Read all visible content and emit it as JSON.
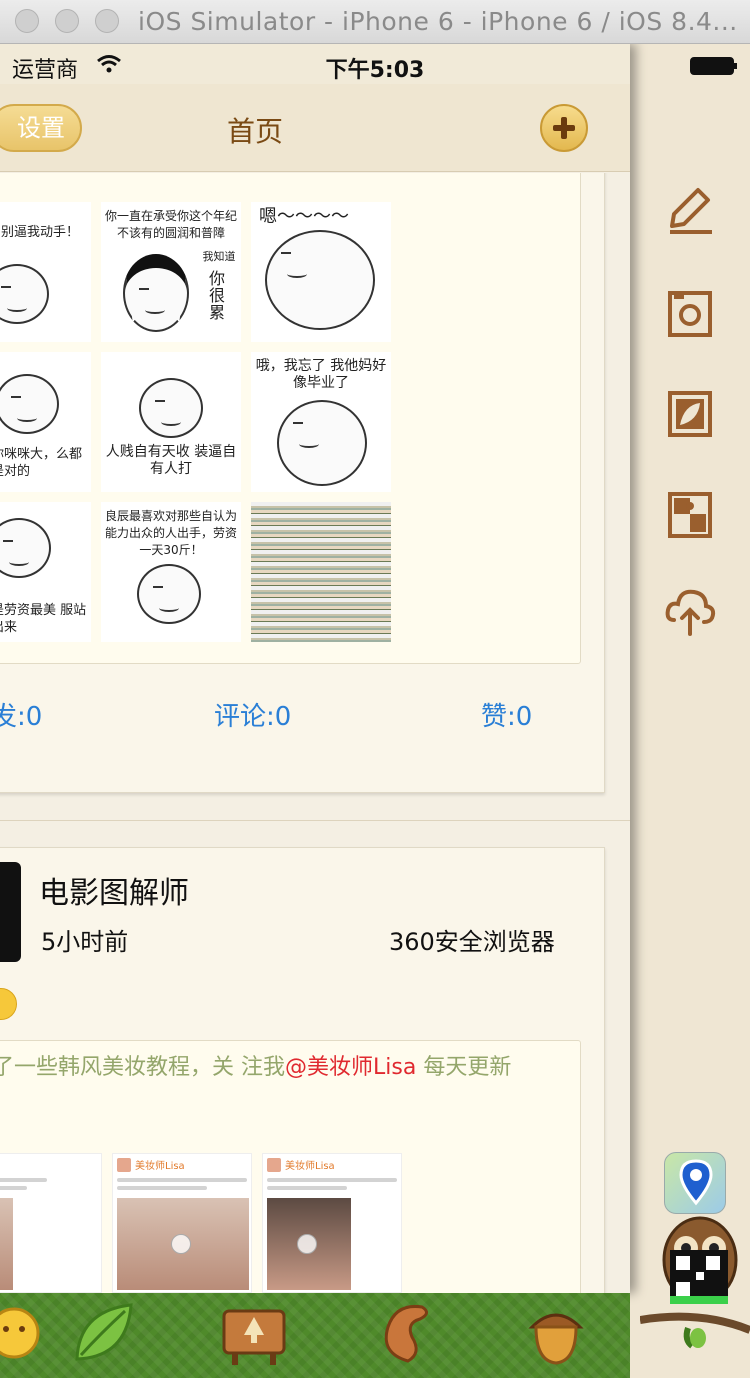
{
  "window": {
    "title": "iOS Simulator - iPhone 6 - iPhone 6 / iOS 8.4..."
  },
  "status_bar": {
    "carrier": "运营商",
    "time": "下午5:03"
  },
  "nav": {
    "settings_label": "设置",
    "title": "首页"
  },
  "post1": {
    "thumbs": [
      {
        "text": "别逼我动手！"
      },
      {
        "text": "你一直在承受你这个年纪不该有的圆润和普障",
        "side": "你很累",
        "side_top": "我知道"
      },
      {
        "text": "嗯～～～～"
      },
      {
        "text": "你咪咪大，么都是对的"
      },
      {
        "text": "人贱自有天收 装逼自有人打"
      },
      {
        "text": "哦，我忘了 我他妈好像毕业了"
      },
      {
        "text": "是劳资最美 服站出来"
      },
      {
        "text": "良辰最喜欢对那些自认为能力出众的人出手，劳资一天30斤！"
      },
      {
        "text": ""
      }
    ],
    "repost": "发:0",
    "comments": "评论:0",
    "likes": "赞:0"
  },
  "post2": {
    "author": "电影图解师",
    "time": "5小时前",
    "source": "360安全浏览器",
    "repost_text_prefix": "了一些韩风美妆教程，关 注我",
    "repost_mention": "@美妆师Lisa",
    "repost_text_suffix": " 每天更新",
    "mini_name": "美妆师Lisa"
  },
  "colors": {
    "link_blue": "#2a7fd6",
    "nav_brown": "#7a4a14",
    "mention_red": "#e0292f",
    "tab_green": "#4f8a2a",
    "menu_brown": "#9a5f2e"
  },
  "icons": {
    "side_menu": [
      "pencil-icon",
      "camera-icon",
      "photo-leaf-icon",
      "puzzle-icon",
      "cloud-upload-icon"
    ],
    "tabs": [
      "smiley-icon",
      "leaf-icon",
      "signboard-icon",
      "squirrel-tail-icon",
      "acorn-icon"
    ]
  }
}
